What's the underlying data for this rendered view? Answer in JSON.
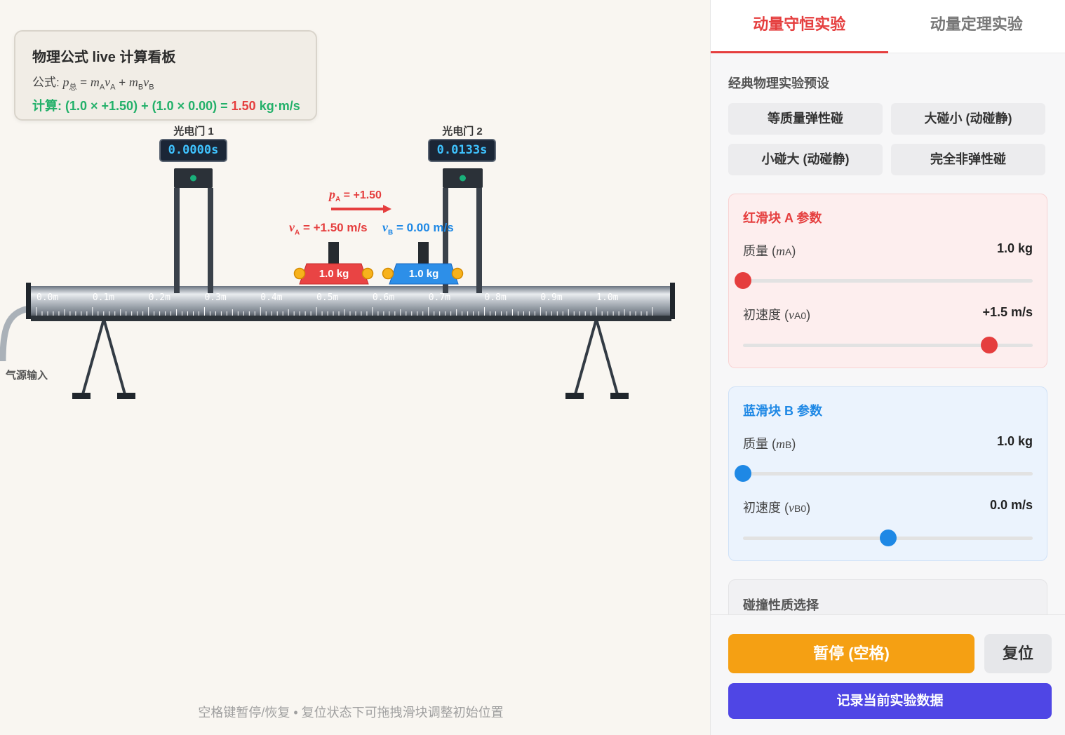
{
  "formula_panel": {
    "title": "物理公式 live 计算看板",
    "formula_prefix": "公式: ",
    "calc_prefix": "计算: (1.0 × +1.50) + (1.0 × 0.00) = ",
    "calc_result": "1.50",
    "calc_unit": " kg·m/s"
  },
  "gates": [
    {
      "label": "光电门 1",
      "time": "0.0000s"
    },
    {
      "label": "光电门 2",
      "time": "0.0133s"
    }
  ],
  "track": {
    "scale_labels": [
      "0.0m",
      "0.1m",
      "0.2m",
      "0.3m",
      "0.4m",
      "0.5m",
      "0.6m",
      "0.7m",
      "0.8m",
      "0.9m",
      "1.0m"
    ],
    "air_label": "气源输入"
  },
  "sliders": {
    "a": {
      "mass_label": "1.0 kg",
      "velocity_text": " = +1.50 m/s",
      "momentum_text": " = +1.50",
      "color": "#e53e3e"
    },
    "b": {
      "mass_label": "1.0 kg",
      "velocity_text": " = 0.00 m/s",
      "color": "#1e88e5"
    }
  },
  "hint": "空格键暂停/恢复 • 复位状态下可拖拽滑块调整初始位置",
  "panel": {
    "tabs": [
      {
        "label": "动量守恒实验",
        "active": true
      },
      {
        "label": "动量定理实验",
        "active": false
      }
    ],
    "presets_title": "经典物理实验预设",
    "presets": [
      "等质量弹性碰",
      "大碰小 (动碰静)",
      "小碰大 (动碰静)",
      "完全非弹性碰"
    ],
    "card_a": {
      "title": "红滑块 A 参数",
      "mass_label": "质量 (",
      "mass_symbol": "m",
      "mass_sub": "A",
      "mass_value": "1.0 kg",
      "mass_fraction": 0.0,
      "vel_label": "初速度 (",
      "vel_symbol": "v",
      "vel_sub": "A0",
      "vel_value": "+1.5 m/s",
      "vel_fraction": 0.85
    },
    "card_b": {
      "title": "蓝滑块 B 参数",
      "mass_label": "质量 (",
      "mass_symbol": "m",
      "mass_sub": "B",
      "mass_value": "1.0 kg",
      "mass_fraction": 0.0,
      "vel_label": "初速度 (",
      "vel_symbol": "v",
      "vel_sub": "B0",
      "vel_value": "0.0 m/s",
      "vel_fraction": 0.5
    },
    "collision_title": "碰撞性质选择",
    "btn_pause": "暂停 (空格)",
    "btn_reset": "复位",
    "btn_record": "记录当前实验数据"
  }
}
